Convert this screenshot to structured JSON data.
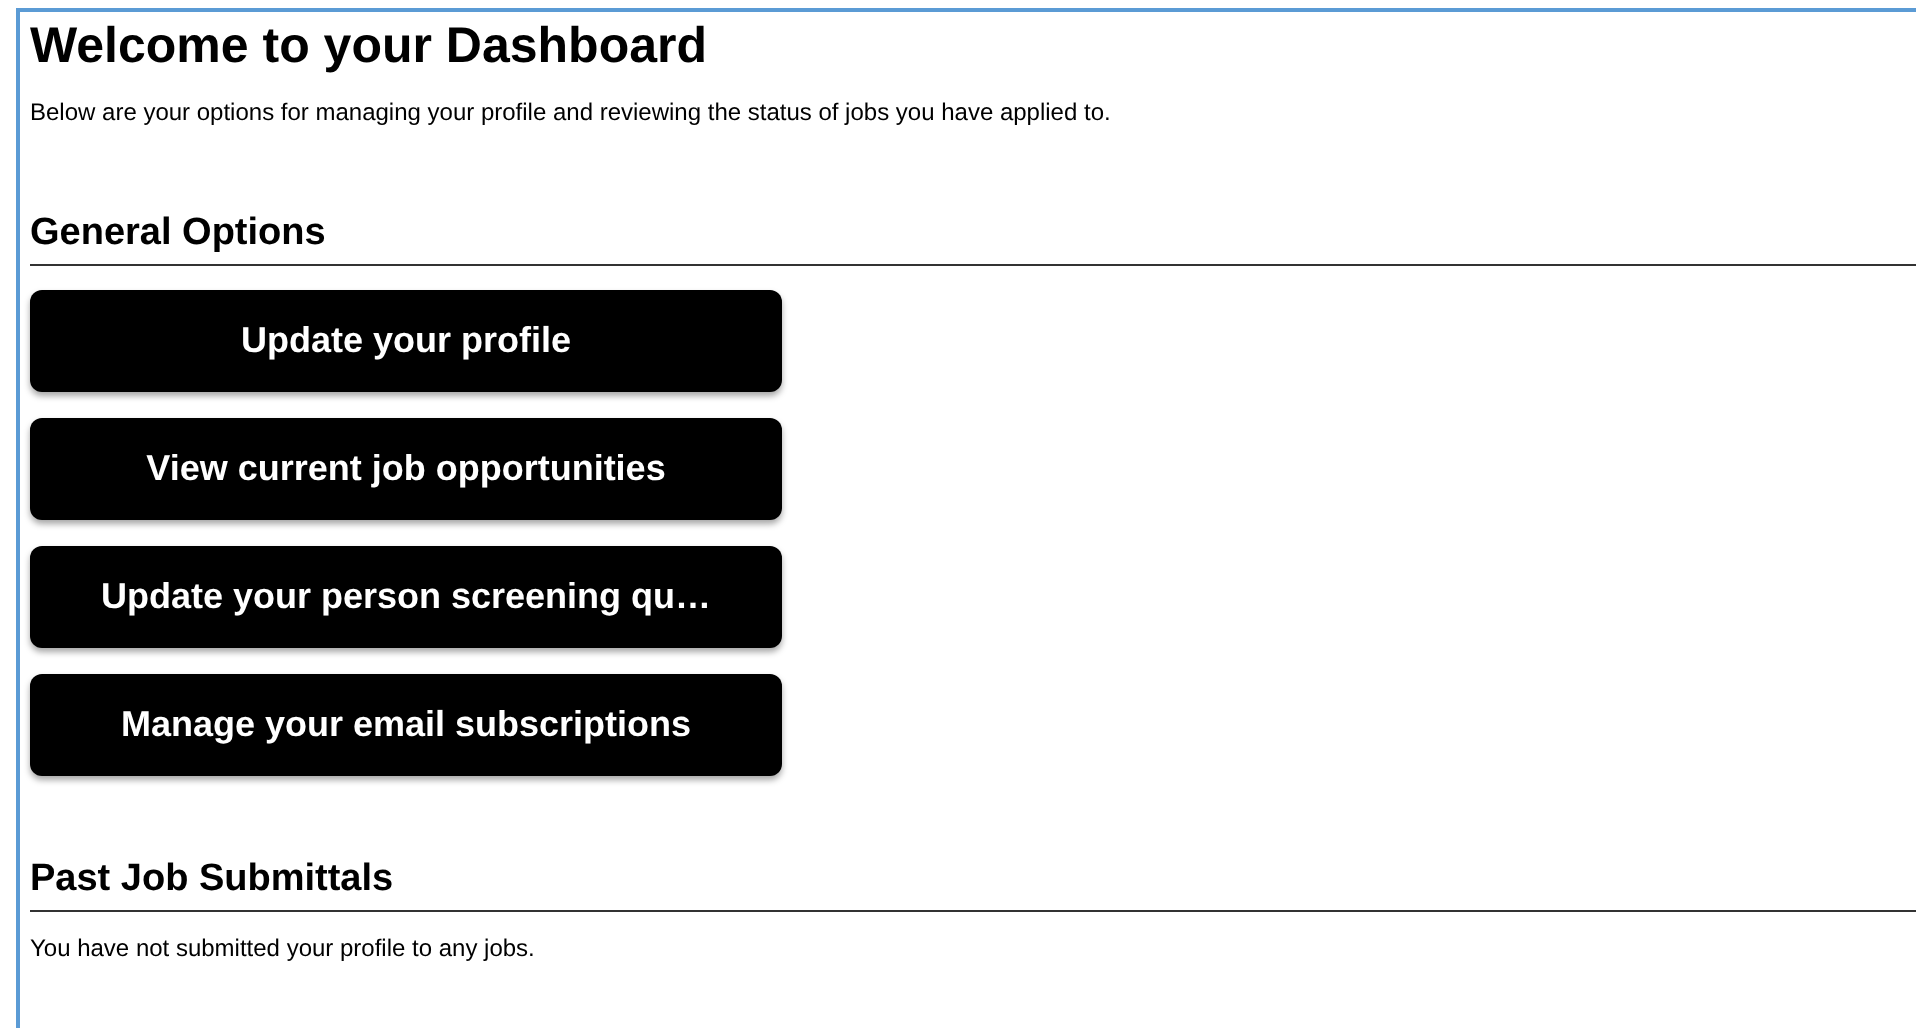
{
  "title": "Welcome to your Dashboard",
  "intro": "Below are your options for managing your profile and reviewing the status of jobs you have applied to.",
  "sections": [
    {
      "heading": "General Options",
      "buttons": [
        "Update your profile",
        "View current job opportunities",
        "Update your person screening qu…",
        "Manage your email subscriptions"
      ]
    },
    {
      "heading": "Past Job Submittals",
      "message": "You have not submitted your profile to any jobs."
    }
  ]
}
